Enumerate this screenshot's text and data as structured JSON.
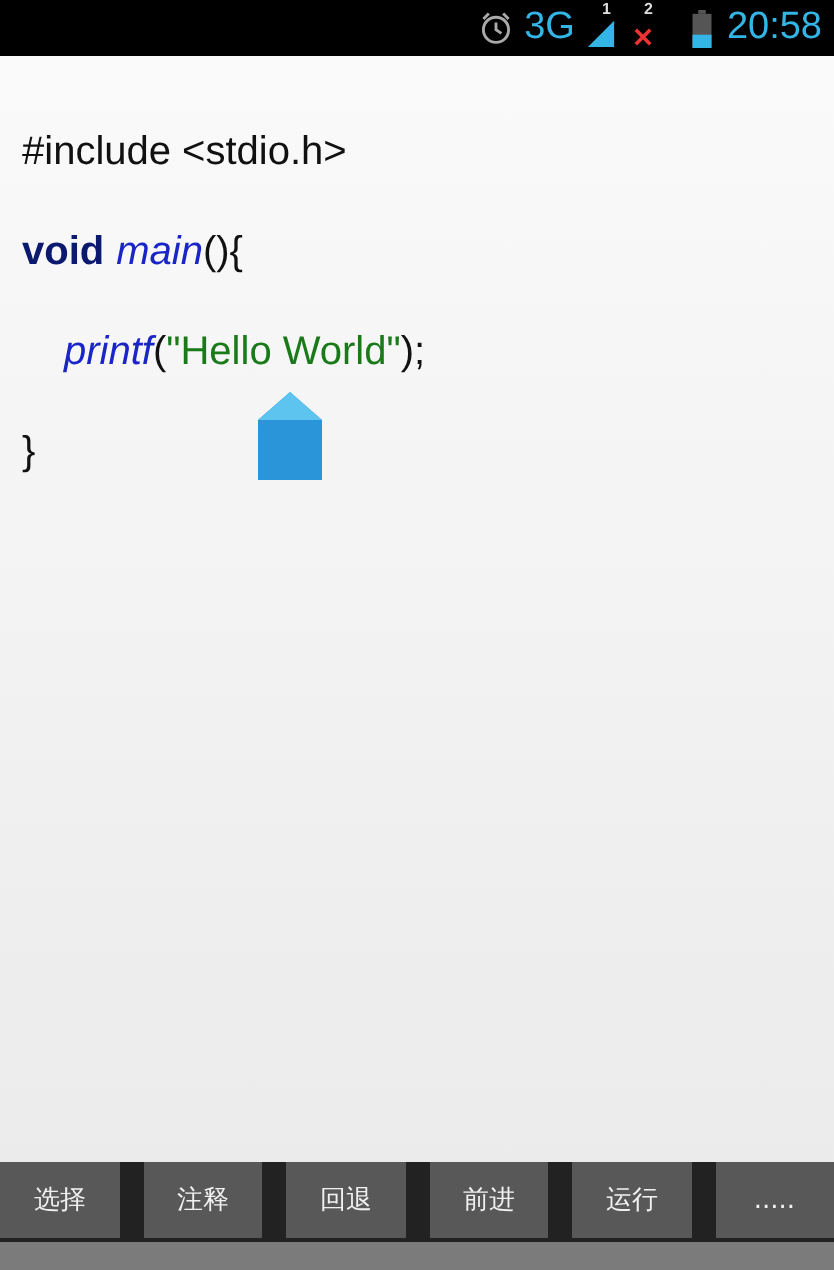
{
  "status_bar": {
    "network": "3G",
    "sim_1": "1",
    "sim_2": "2",
    "time": "20:58"
  },
  "code": [
    [
      {
        "kind": "plain",
        "text": "#include <stdio.h>"
      }
    ],
    [
      {
        "kind": "keyword",
        "text": "void"
      },
      {
        "kind": "function",
        "text": "main"
      },
      {
        "kind": "plain",
        "text": "(){"
      }
    ],
    [
      {
        "kind": "function",
        "text": "printf"
      },
      {
        "kind": "plain",
        "text": "("
      },
      {
        "kind": "string",
        "text": "\"Hello World\""
      },
      {
        "kind": "plain",
        "text": ");"
      }
    ],
    [
      {
        "kind": "plain",
        "text": "}"
      }
    ]
  ],
  "toolbar": [
    "选择",
    "注释",
    "回退",
    "前进",
    "运行",
    "....."
  ]
}
